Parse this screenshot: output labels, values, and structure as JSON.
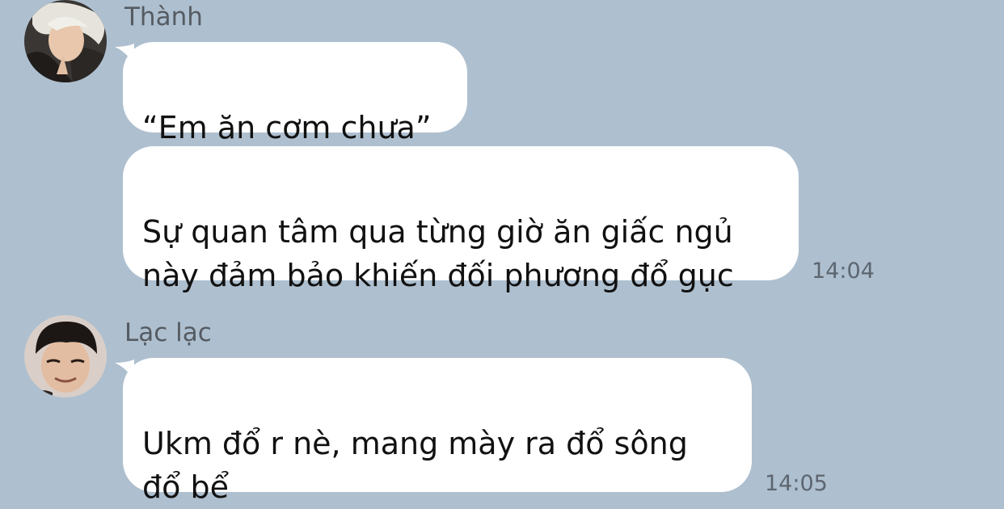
{
  "messages": [
    {
      "sender": "Thành",
      "avatar": "avatar-thanh",
      "bubbles": [
        "“Em ăn cơm chưa”",
        "Sự quan tâm qua từng giờ ăn giấc ngủ\nnày đảm bảo khiến đối phương đổ gục"
      ],
      "time": "14:04"
    },
    {
      "sender": "Lạc lạc",
      "avatar": "avatar-lac",
      "bubbles": [
        "Ukm đổ r nè, mang mày ra đổ sông\nđổ bể"
      ],
      "time": "14:05"
    }
  ],
  "colors": {
    "background": "#aebfcf",
    "bubble": "#ffffff",
    "sender_text": "#555b62",
    "time_text": "#5d6670"
  }
}
